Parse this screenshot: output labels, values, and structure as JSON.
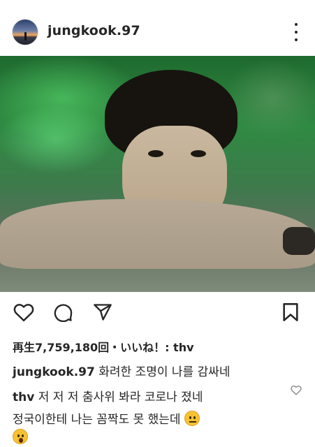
{
  "post": {
    "username": "jungkook.97",
    "more_label": "more options"
  },
  "media": {
    "sound_state": "muted"
  },
  "actions": {
    "like_icon": "heart-outline-icon",
    "comment_icon": "comment-bubble-icon",
    "share_icon": "send-arrow-icon",
    "save_icon": "bookmark-icon"
  },
  "stats": {
    "views_text": "再生7,759,180回・いいね！: thv"
  },
  "caption": {
    "username": "jungkook.97",
    "text": "화려한 조명이 나를 감싸네"
  },
  "comment": {
    "username": "thv",
    "line1": "저 저 저 춤사위 봐라 코로나 졌네",
    "line2": "정국이한테 나는 꼼짝도 못 했는데"
  },
  "colors": {
    "text": "#262626",
    "emoji_yellow": "#f6c233"
  }
}
